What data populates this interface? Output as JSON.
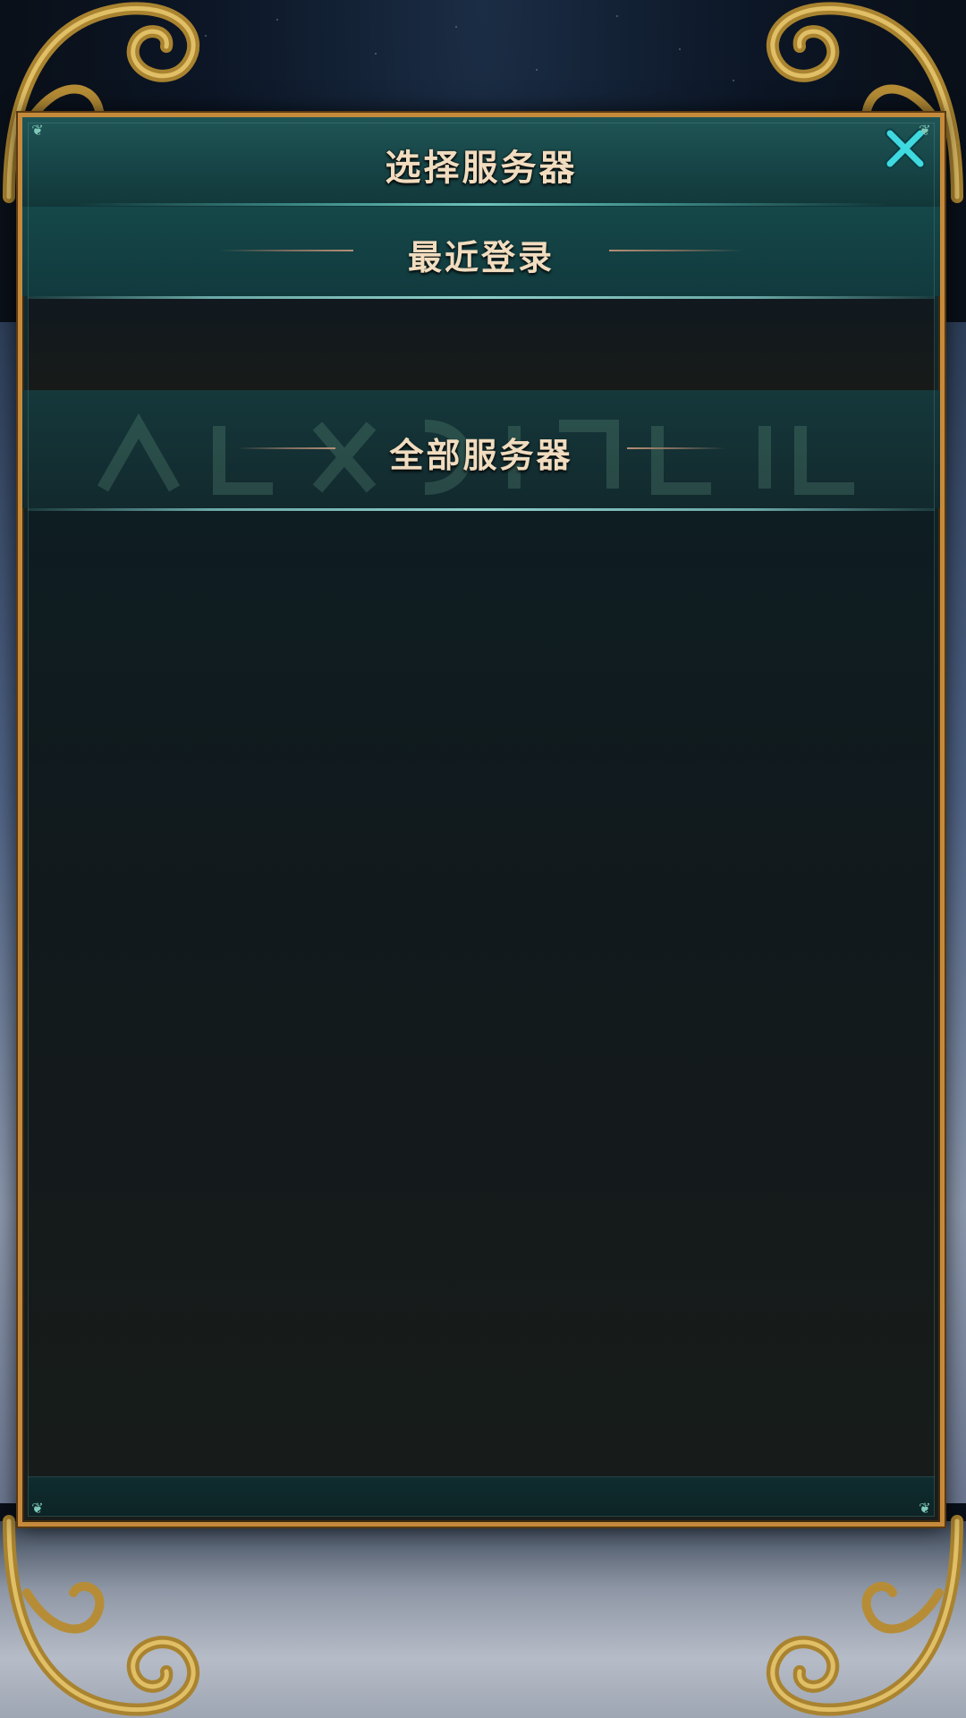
{
  "dialog": {
    "title": "选择服务器",
    "close_icon": "close-x-icon",
    "close_color": "#3fd9e0"
  },
  "sections": {
    "recent_label": "最近登录",
    "all_label": "全部服务器"
  },
  "theme": {
    "frame_gold": "#c58a3b",
    "text_color": "#f1dcbf",
    "panel_teal": "#164345"
  }
}
